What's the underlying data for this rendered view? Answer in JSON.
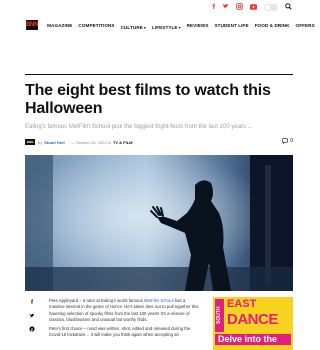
{
  "header": {
    "logo_text": "BNN",
    "nav": [
      {
        "label": "MAGAZINE",
        "has_dropdown": false
      },
      {
        "label": "COMPETITIONS",
        "has_dropdown": false
      },
      {
        "label": "CULTURE",
        "has_dropdown": true
      },
      {
        "label": "LIFESTYLE",
        "has_dropdown": true
      },
      {
        "label": "REVIEWS",
        "has_dropdown": false
      },
      {
        "label": "STUDENT LIFE",
        "has_dropdown": false
      },
      {
        "label": "FOOD & DRINK",
        "has_dropdown": false
      },
      {
        "label": "OFFERS",
        "has_dropdown": false
      }
    ],
    "social_icons": [
      "facebook-icon",
      "twitter-icon",
      "instagram-icon",
      "youtube-icon"
    ],
    "accent_color": "#e53935"
  },
  "article": {
    "title": "The eight best films to watch this Halloween",
    "subtitle": "Ealing's famous MetFilm School pick the biggest fright-fests from the last 100 years ...",
    "meta": {
      "by": "by",
      "author": "Stuart Holt",
      "date": "October 26, 2022 in",
      "category": "TV & FILM",
      "comments": "0"
    },
    "share_icons": [
      "facebook-icon",
      "twitter-icon",
      "pinterest-icon"
    ],
    "body": {
      "p1_a": "Pete Appleyard – a tutor at Ealing's world famous ",
      "p1_link": "MetFilm School",
      "p1_b": " has a massive interest in the genre of Horror. He's taken time out to pull together this haunting selection of spooky films from the last 100 years! It's a mixture of classics, blockbusters and unusual but worthy finds.",
      "p2": "Pete's first choice – nosd was written, shot, edited and released during the Covid-19 lockdown… it will make you think again when accepting an"
    }
  },
  "ad": {
    "south": "SOUTH",
    "east": "EAST",
    "dance": "DANCE",
    "delve": "Delve into the",
    "colors": {
      "background": "#f7d21f",
      "accent": "#e0207f"
    }
  }
}
